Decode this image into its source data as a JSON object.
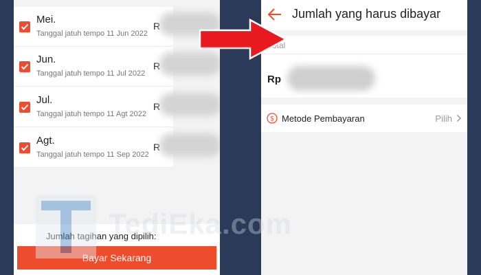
{
  "bills": [
    {
      "month": "Mei.",
      "due": "Tanggal jatuh tempo 11 Jun 2022",
      "amount_prefix": "R"
    },
    {
      "month": "Jun.",
      "due": "Tanggal jatuh tempo 11 Jul 2022",
      "amount_prefix": "R"
    },
    {
      "month": "Jul.",
      "due": "Tanggal jatuh tempo 11 Agt 2022",
      "amount_prefix": "R"
    },
    {
      "month": "Agt.",
      "due": "Tanggal jatuh tempo 11 Sep 2022",
      "amount_prefix": "R"
    }
  ],
  "footer": {
    "selected_total_label": "Jumlah tagihan yang dipilih:",
    "pay_button": "Bayar Sekarang"
  },
  "payment_page": {
    "title": "Jumlah yang harus dibayar",
    "total_label": "Total",
    "currency": "Rp",
    "payment_method_label": "Metode Pembayaran",
    "choose_label": "Pilih"
  },
  "watermark": {
    "logo_letter": "T",
    "text": "TediEka.com"
  },
  "colors": {
    "accent": "#ee4d2d",
    "arrow": "#e8191f",
    "background": "#2b3a58"
  },
  "icons": [
    "checkbox-checked-icon",
    "back-arrow-icon",
    "dollar-circle-icon",
    "chevron-right-icon",
    "red-arrow"
  ]
}
